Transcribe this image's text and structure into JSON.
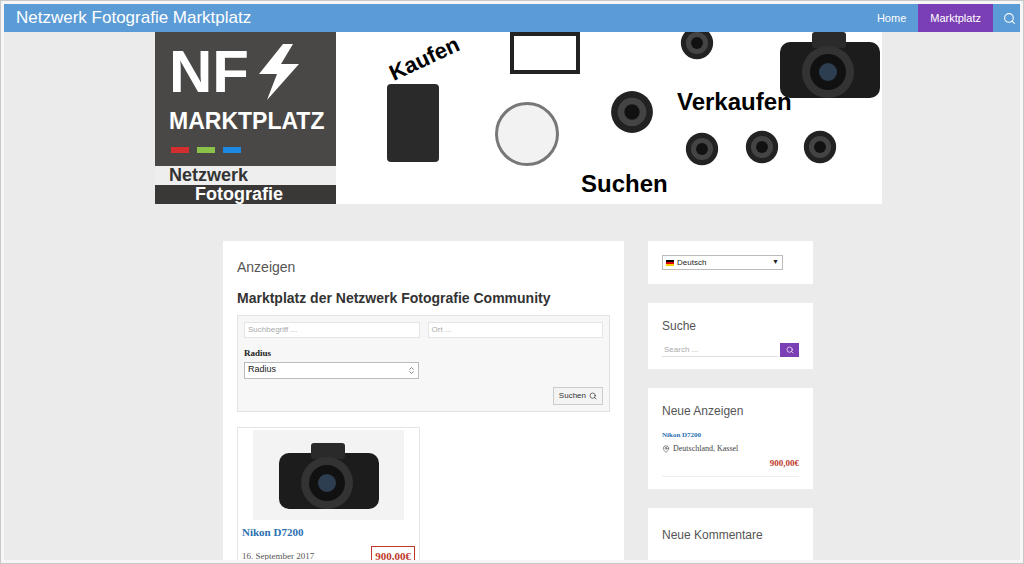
{
  "site_title": "Netzwerk Fotografie Marktplatz",
  "nav": [
    {
      "label": "Home",
      "selected": false
    },
    {
      "label": "Marktplatz",
      "selected": true
    }
  ],
  "banner": {
    "logo_mark": "NF",
    "logo_title": "MARKTPLATZ",
    "logo_line_1": "Netzwerk",
    "logo_line_2": "Fotografie",
    "color_bars": [
      {
        "color": "#d32f2f"
      },
      {
        "color": "#8bc34a"
      },
      {
        "color": "#1e88e5"
      }
    ],
    "words": [
      "Kaufen",
      "Verkaufen",
      "Suchen"
    ]
  },
  "main": {
    "section_label": "Anzeigen",
    "title": "Marktplatz der Netzwerk Fotografie Community",
    "search_form": {
      "keyword_placeholder": "Suchbegriff ...",
      "location_placeholder": "Ort ...",
      "radius_label": "Radius",
      "radius_value": "Radius",
      "button": "Suchen"
    },
    "listings": [
      {
        "title": "Nikon D7200",
        "date": "16. September 2017",
        "price": "900,00€"
      }
    ]
  },
  "sidebar": {
    "language": {
      "value": "Deutsch",
      "arrow": "▼"
    },
    "search": {
      "title": "Suche",
      "placeholder": "Search ..."
    },
    "new_ads": {
      "title": "Neue Anzeigen",
      "items": [
        {
          "title": "Nikon D7200",
          "location": "Deutschland, Kassel",
          "price": "900,00€"
        }
      ]
    },
    "comments": {
      "title": "Neue Kommentare"
    }
  }
}
